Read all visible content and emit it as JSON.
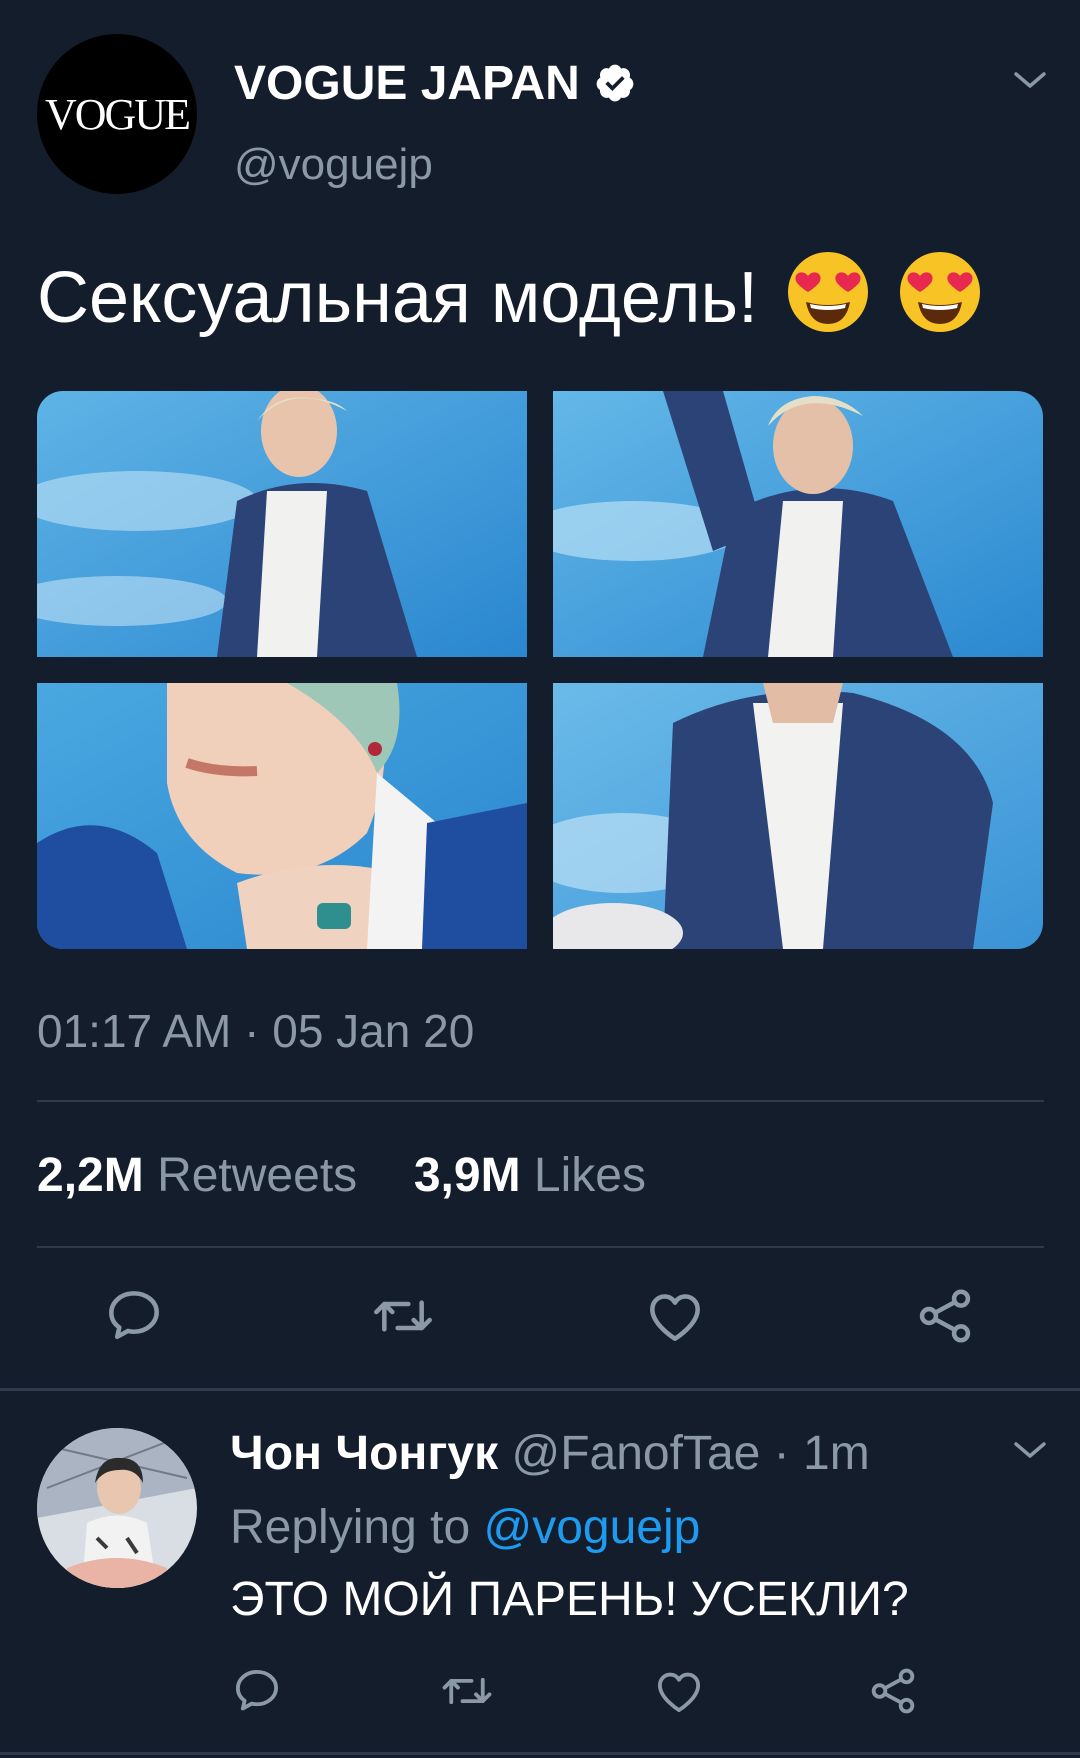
{
  "tweet": {
    "avatar_logo": "VOGUE",
    "display_name": "VOGUE JAPAN",
    "handle": "@voguejp",
    "text": "Сексуальная модель!",
    "emojis": [
      "heart-eyes-emoji",
      "heart-eyes-emoji"
    ],
    "timestamp": "01:17 AM · 05 Jan 20",
    "retweets_count": "2,2M",
    "retweets_label": "Retweets",
    "likes_count": "3,9M",
    "likes_label": "Likes"
  },
  "reply": {
    "display_name": "Чон Чонгук",
    "handle": "@FanofTae",
    "time": "· 1m",
    "replying_prefix": "Replying to",
    "replying_handle": "@voguejp",
    "text": "ЭТО МОЙ ПАРЕНЬ! УСЕКЛИ?"
  },
  "icons": {
    "verified": "verified-badge-icon",
    "chevron": "chevron-down-icon",
    "reply": "reply-icon",
    "retweet": "retweet-icon",
    "like": "heart-icon",
    "share": "share-icon"
  },
  "colors": {
    "background": "#141d2b",
    "muted_text": "#8b98a5",
    "link": "#1d9bf0",
    "divider": "#2f3b4b"
  }
}
